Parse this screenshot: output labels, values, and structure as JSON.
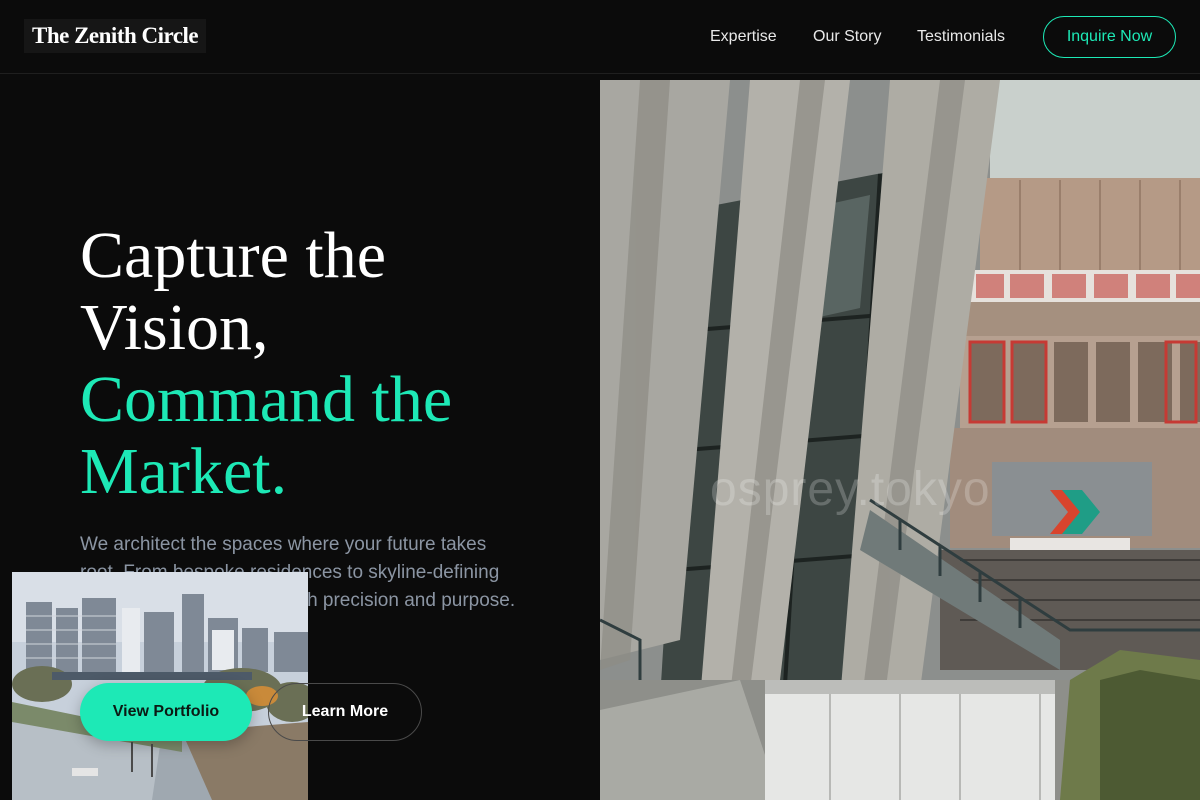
{
  "header": {
    "logo": "The Zenith Circle",
    "nav": [
      "Expertise",
      "Our Story",
      "Testimonials"
    ],
    "cta": "Inquire Now"
  },
  "hero": {
    "headline_line1": "Capture the",
    "headline_line2": "Vision,",
    "headline_accent_line1": "Command the",
    "headline_accent_line2": "Market.",
    "subtext": "We architect the spaces where your future takes root. From bespoke residences to skyline-defining developments, we build with precision and purpose.",
    "primary_button": "View Portfolio",
    "secondary_button": "Learn More"
  },
  "image": {
    "watermark": "osprey.tokyo"
  },
  "colors": {
    "accent": "#1de9b6",
    "background": "#0b0b0b",
    "subtext": "#8b95a3"
  }
}
